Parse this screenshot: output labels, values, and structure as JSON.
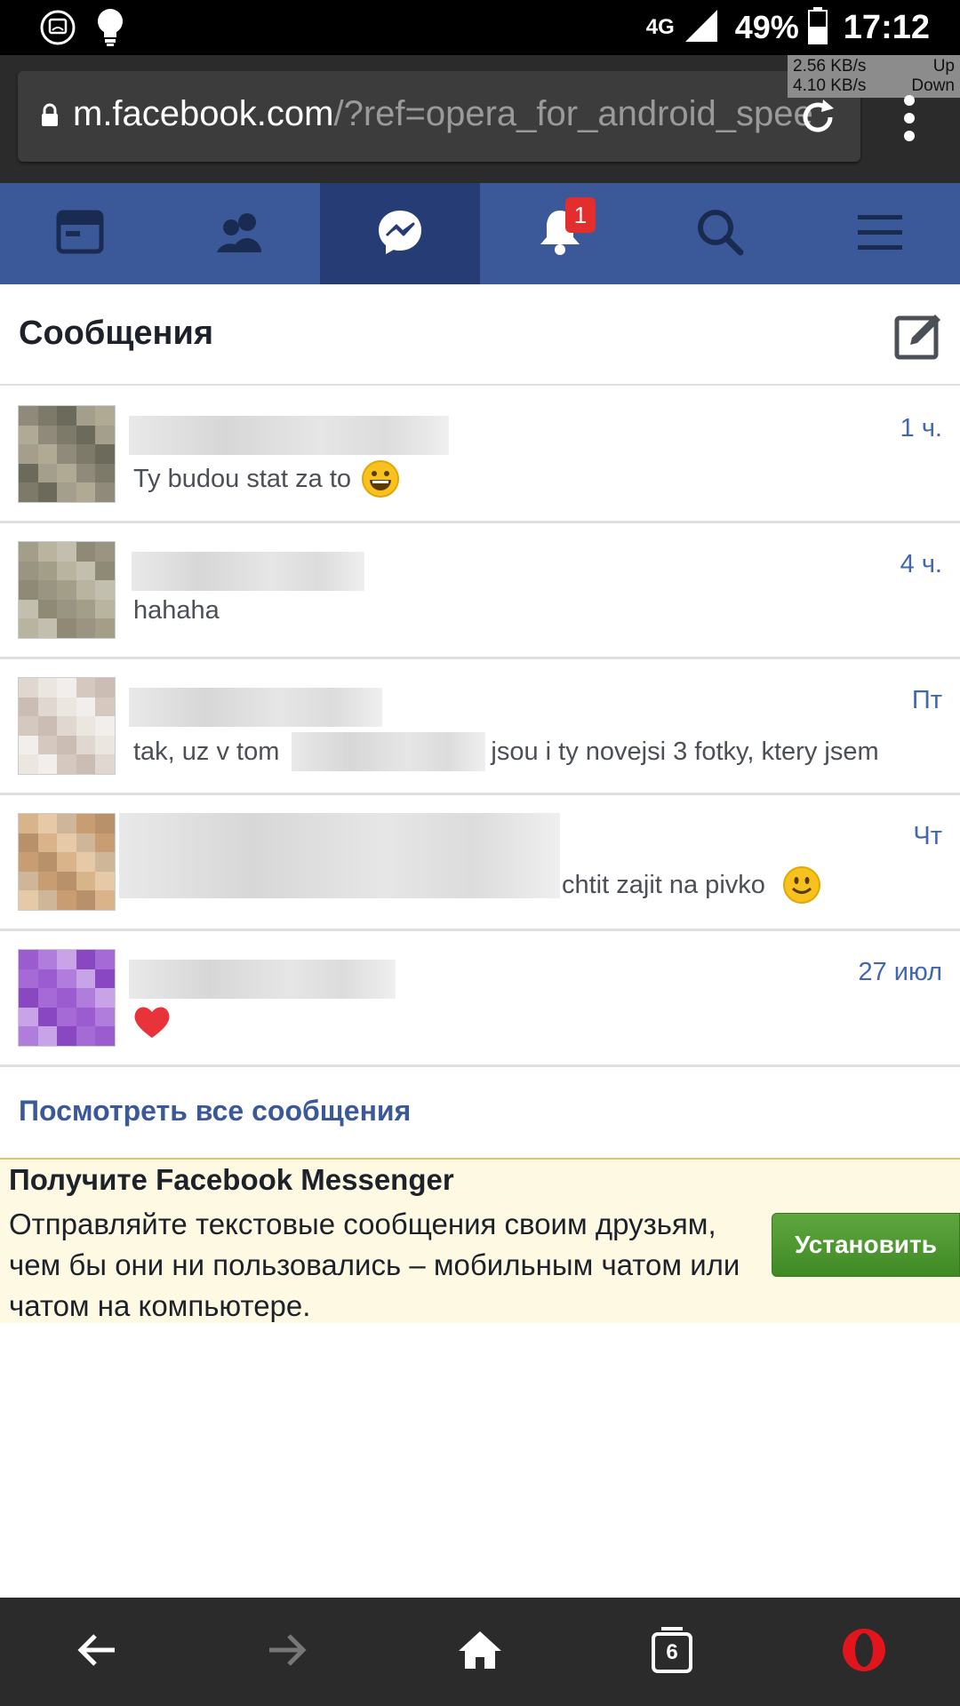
{
  "status_bar": {
    "network_type": "4G",
    "battery": "49%",
    "time": "17:12",
    "speed_up": "2.56 KB/s",
    "speed_up_label": "Up",
    "speed_down": "4.10 KB/s",
    "speed_down_label": "Down"
  },
  "browser": {
    "url_host": "m.facebook.com",
    "url_rest": "/?ref=opera_for_android_spee",
    "tab_count": "6"
  },
  "fb_nav": {
    "notification_badge": "1",
    "active_tab": "messages"
  },
  "messages": {
    "title": "Сообщения",
    "threads": [
      {
        "snippet": "Ty budou stat za to",
        "emoji": "grinning-face",
        "time": "1 ч."
      },
      {
        "snippet": "hahaha",
        "time": "4 ч."
      },
      {
        "snippet_before": "tak, uz v tom",
        "snippet_after": "jsou i ty novejsi 3 fotky, ktery jsem",
        "time": "Пт"
      },
      {
        "snippet": "chtit zajit na pivko",
        "emoji": "slightly-smiling-face",
        "time": "Чт"
      },
      {
        "snippet": "",
        "emoji": "red-heart",
        "time": "27 июл"
      }
    ],
    "see_all": "Посмотреть все сообщения"
  },
  "promo": {
    "title": "Получите Facebook Messenger",
    "body": "Отправляйте текстовые сообщения своим друзьям, чем бы они ни пользовались – мобильным чатом или чатом на компьютере.",
    "button": "Установить"
  },
  "colors": {
    "fb_blue": "#3b5998",
    "fb_blue_active": "#253d74",
    "link_blue": "#4267b2",
    "install_green": "#4c9a2a",
    "promo_bg": "#fef9e3"
  }
}
